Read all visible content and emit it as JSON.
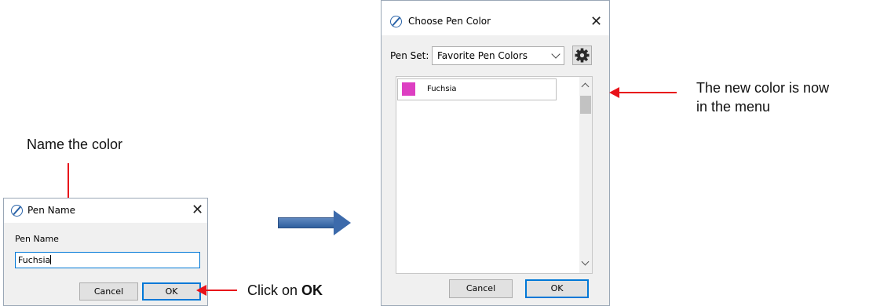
{
  "annotations": {
    "name_the_color": "Name the color",
    "click_on": "Click on ",
    "click_on_bold": "OK",
    "new_color_line1": "The new color is now",
    "new_color_line2": "in the menu"
  },
  "pen_name_dialog": {
    "title": "Pen Name",
    "close_icon": "close-icon",
    "field_label": "Pen Name",
    "field_value": "Fuchsia",
    "cancel_label": "Cancel",
    "ok_label": "OK"
  },
  "choose_pen_color_dialog": {
    "title": "Choose Pen Color",
    "close_icon": "close-icon",
    "pen_set_label": "Pen Set:",
    "pen_set_value": "Favorite Pen Colors",
    "settings_icon": "gear-icon",
    "pens": [
      {
        "name": "Fuchsia",
        "color": "#dd3fc2"
      }
    ],
    "cancel_label": "Cancel",
    "ok_label": "OK"
  },
  "colors": {
    "arrow_red": "#e8121a",
    "arrow_blue": "#3c6aab",
    "accent": "#0078d7"
  }
}
